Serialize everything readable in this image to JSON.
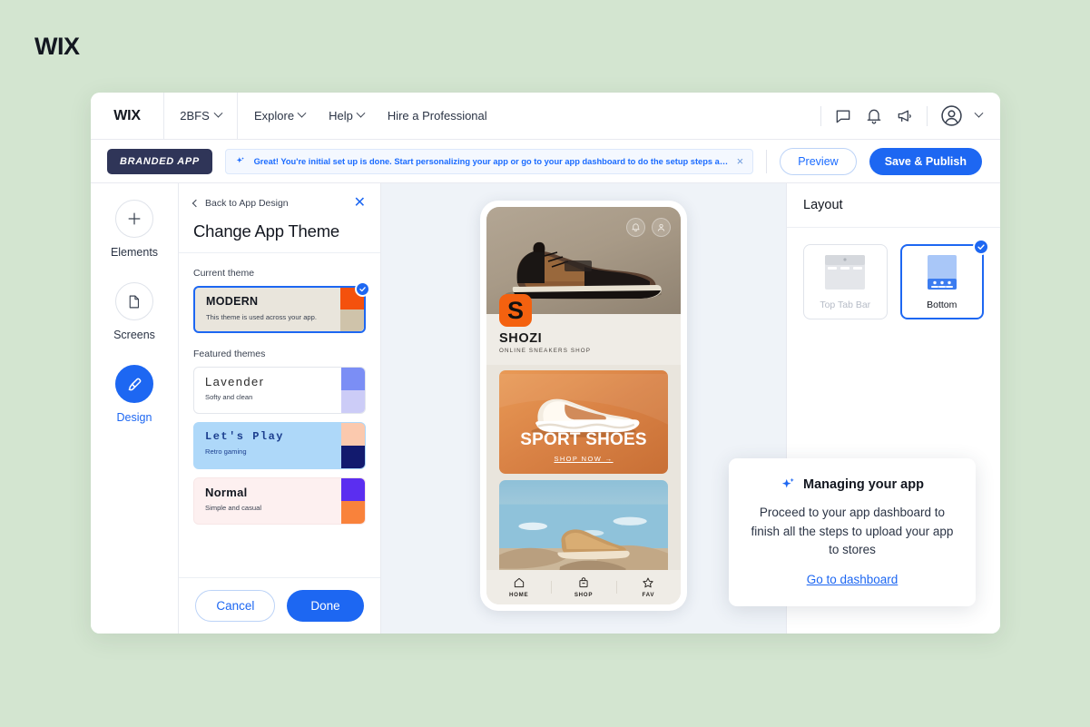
{
  "brand": {
    "wordmark": "WIX"
  },
  "topbar": {
    "logo": "WIX",
    "site_name": "2BFS",
    "menus": [
      {
        "label": "Explore",
        "caret": true
      },
      {
        "label": "Help",
        "caret": true
      },
      {
        "label": "Hire a Professional",
        "caret": false
      }
    ],
    "icons": [
      "chat-icon",
      "bell-icon",
      "megaphone-icon",
      "account-icon",
      "chevron-down-icon"
    ]
  },
  "subbar": {
    "badge": "BRANDED APP",
    "banner_text": "Great! You're initial set up is done. Start personalizing your app or go to your app dashboard to do the setup  steps and  go live faster.",
    "banner_close": "×",
    "preview_label": "Preview",
    "publish_label": "Save & Publish",
    "accent_blue": "#1d67f2",
    "banner_blue": "#1a6bff"
  },
  "rail": {
    "items": [
      {
        "label": "Elements",
        "icon": "plus-icon",
        "active": false
      },
      {
        "label": "Screens",
        "icon": "page-icon",
        "active": false
      },
      {
        "label": "Design",
        "icon": "brush-icon",
        "active": true
      }
    ]
  },
  "panel": {
    "back_label": "Back to App Design",
    "close": "✕",
    "title": "Change App Theme",
    "current_label": "Current theme",
    "featured_label": "Featured themes",
    "current_theme": {
      "name": "MODERN",
      "desc": "This theme is used across your app.",
      "bg": "#e9e5dc",
      "swatch_top": "#f4510d",
      "swatch_bottom": "#cfc3aa",
      "selected": true
    },
    "featured_themes": [
      {
        "name": "Lavender",
        "desc": "Softy and clean",
        "bg": "#ffffff",
        "name_color": "#2b2b2b",
        "swatch_top": "#7b8ef5",
        "swatch_bottom": "#ccccf7"
      },
      {
        "name": "Let's Play",
        "desc": "Retro gaming",
        "bg": "#aed8f9",
        "name_color": "#1c3f8f",
        "swatch_top": "#fbc9ae",
        "swatch_bottom": "#121a6e"
      },
      {
        "name": "Normal",
        "desc": "Simple and casual",
        "bg": "#fdf0f0",
        "name_color": "#131720",
        "swatch_top": "#5b2ef0",
        "swatch_bottom": "#f9823b"
      }
    ],
    "cancel_label": "Cancel",
    "done_label": "Done"
  },
  "phone_preview": {
    "header_icons": [
      "bell-icon",
      "person-icon"
    ],
    "logo_letter": "S",
    "brand_name": "SHOZI",
    "brand_sub": "ONLINE SNEAKERS SHOP",
    "promo_title": "SPORT SHOES",
    "promo_cta": "SHOP NOW →",
    "tabs": [
      {
        "label": "HOME",
        "icon": "home-icon"
      },
      {
        "label": "SHOP",
        "icon": "bag-icon"
      },
      {
        "label": "FAV",
        "icon": "star-icon"
      }
    ]
  },
  "right_panel": {
    "title": "Layout",
    "options": [
      {
        "label": "Top Tab Bar",
        "selected": false
      },
      {
        "label": "Bottom",
        "selected": true
      }
    ]
  },
  "tooltip": {
    "icon": "sparkle-icon",
    "title": "Managing your app",
    "body": "Proceed to your app dashboard to finish all the steps to upload your app to stores",
    "link": "Go to dashboard"
  }
}
